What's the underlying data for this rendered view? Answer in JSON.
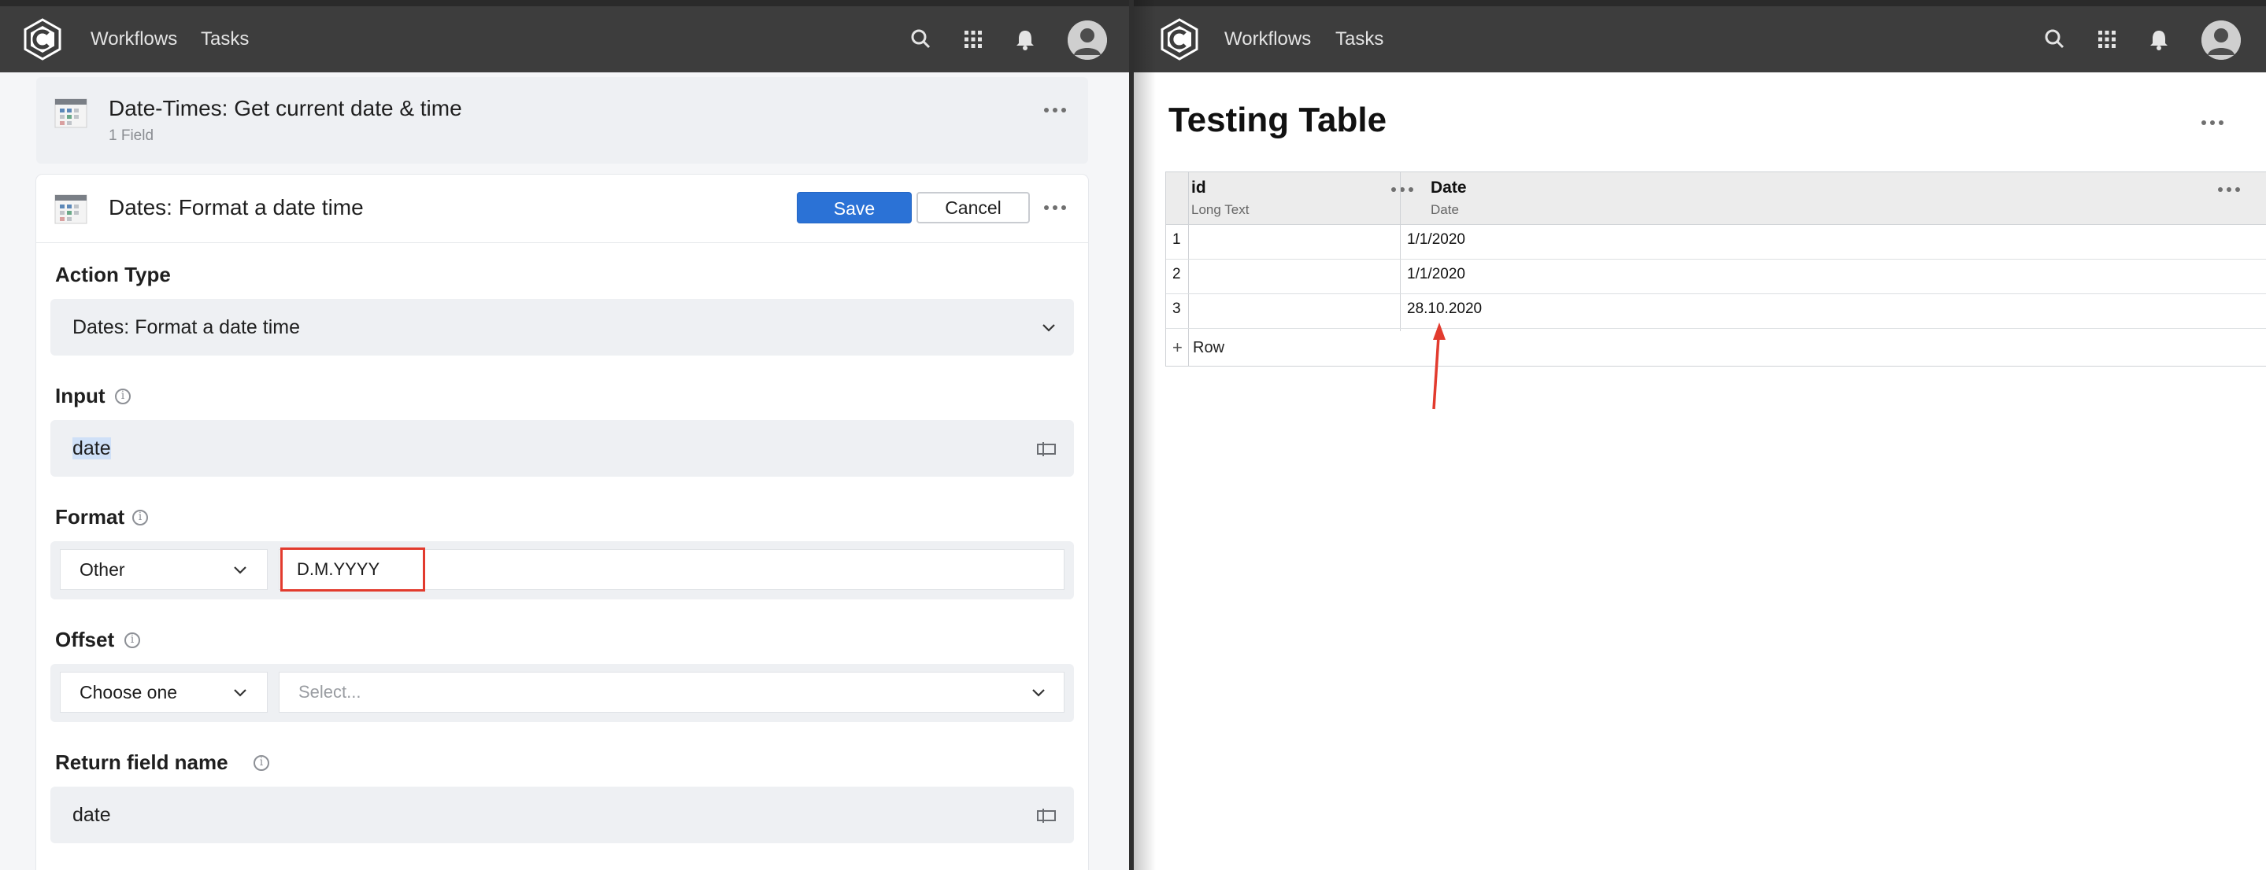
{
  "left_window": {
    "nav": {
      "workflows": "Workflows",
      "tasks": "Tasks"
    },
    "previous_step": {
      "title": "Date-Times: Get current date & time",
      "subtitle": "1 Field"
    },
    "current_step": {
      "title": "Dates: Format a date time",
      "save_label": "Save",
      "cancel_label": "Cancel",
      "action_type": {
        "label": "Action Type",
        "value": "Dates: Format a date time"
      },
      "input": {
        "label": "Input",
        "value": "date"
      },
      "format": {
        "label": "Format",
        "select_value": "Other",
        "custom_value": "D.M.YYYY"
      },
      "offset": {
        "label": "Offset",
        "select_value": "Choose one",
        "placeholder": "Select..."
      },
      "return_field": {
        "label": "Return field name",
        "value": "date"
      }
    }
  },
  "right_window": {
    "nav": {
      "workflows": "Workflows",
      "tasks": "Tasks"
    },
    "page_title": "Testing Table",
    "columns": [
      {
        "name": "id",
        "type": "Long Text"
      },
      {
        "name": "Date",
        "type": "Date"
      }
    ],
    "rows": [
      {
        "num": "1",
        "id": "",
        "date": "1/1/2020"
      },
      {
        "num": "2",
        "id": "",
        "date": "1/1/2020"
      },
      {
        "num": "3",
        "id": "",
        "date": "28.10.2020"
      }
    ],
    "add_row_label": "Row"
  },
  "colors": {
    "topbar": "#3d3d3d",
    "primary_button": "#2b72d6",
    "highlight": "#e23b2e"
  }
}
